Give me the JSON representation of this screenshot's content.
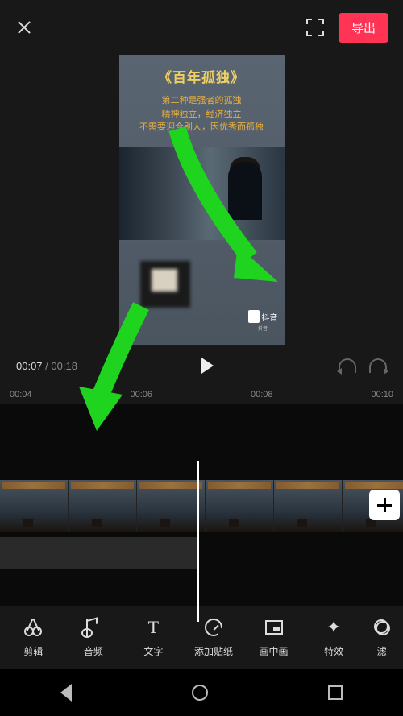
{
  "header": {
    "export_label": "导出"
  },
  "preview": {
    "title": "《百年孤独》",
    "line1": "第二种是强者的孤独",
    "line2": "精神独立，经济独立",
    "line3": "不需要迎合别人，因优秀而孤独",
    "watermark": "抖音",
    "watermark_sub": "抖音"
  },
  "controls": {
    "current_time": "00:07",
    "total_time": "00:18"
  },
  "ruler": {
    "marks": [
      "00:04",
      "00:06",
      "00:08",
      "00:10"
    ]
  },
  "tabs": [
    {
      "id": "cut",
      "label": "剪辑"
    },
    {
      "id": "audio",
      "label": "音频"
    },
    {
      "id": "text",
      "label": "文字"
    },
    {
      "id": "sticker",
      "label": "添加贴纸"
    },
    {
      "id": "pip",
      "label": "画中画"
    },
    {
      "id": "fx",
      "label": "特效"
    },
    {
      "id": "filter",
      "label": "滤"
    }
  ]
}
